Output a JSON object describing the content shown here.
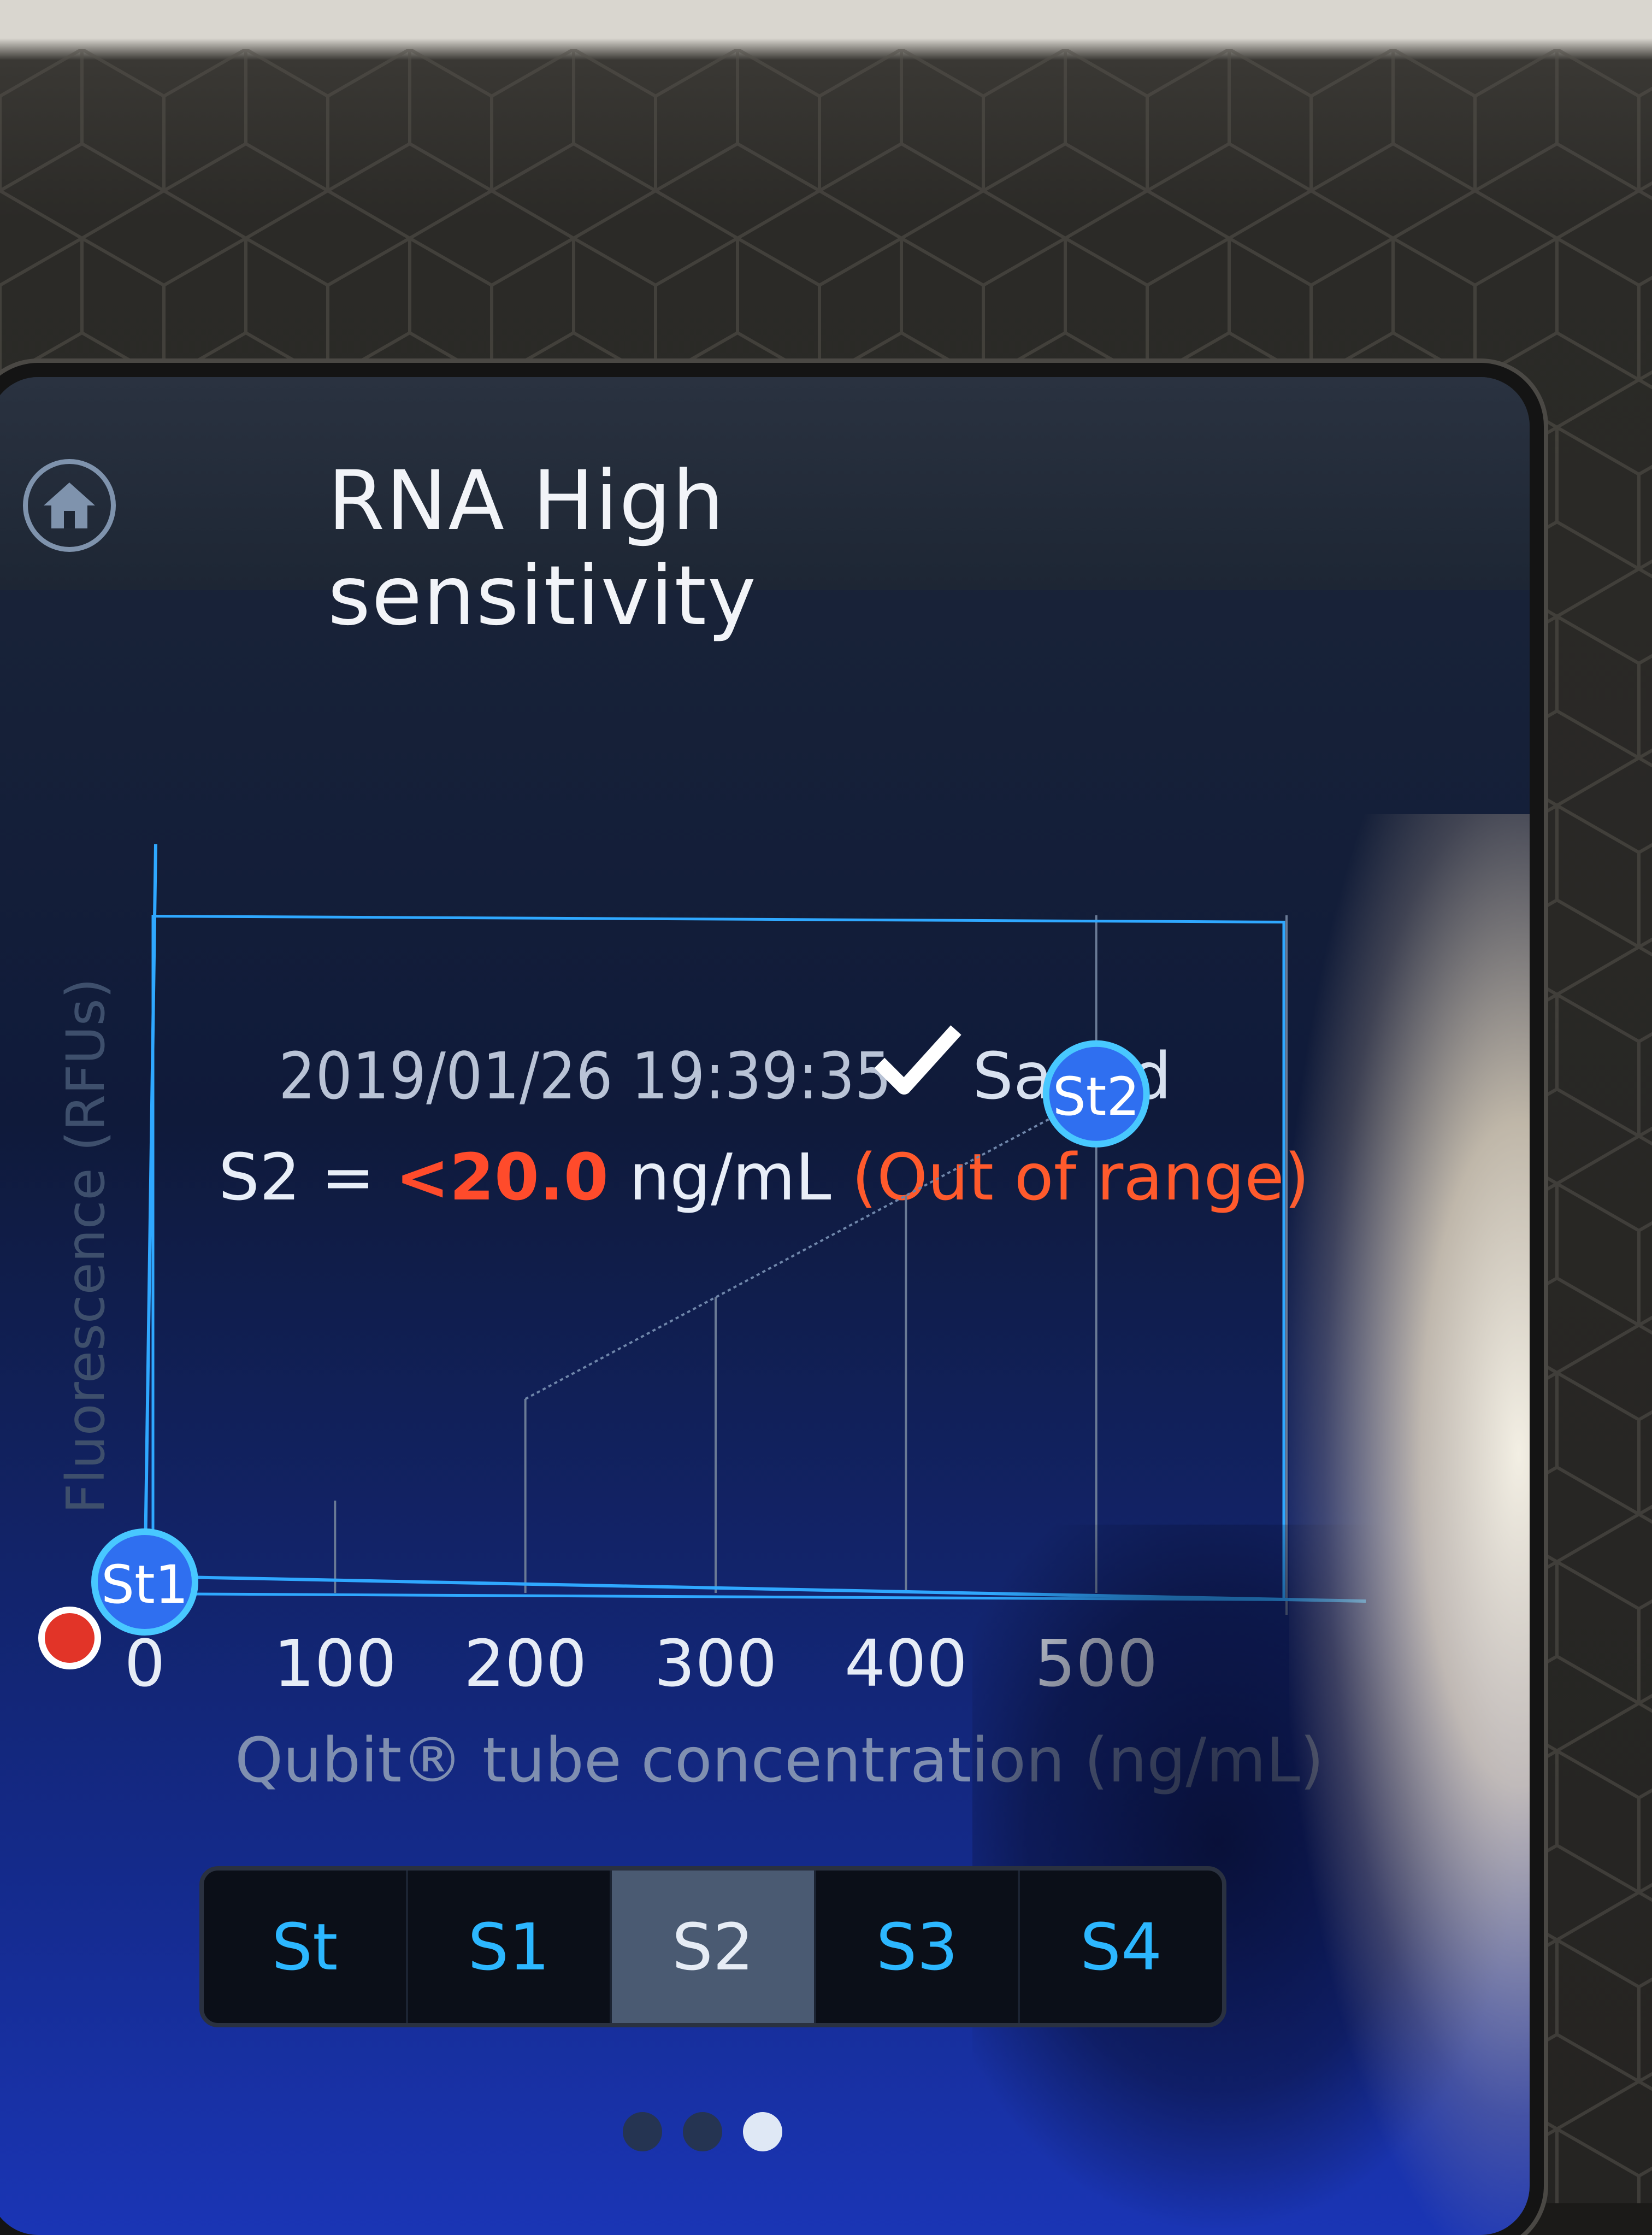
{
  "header": {
    "title": "RNA High sensitivity"
  },
  "status": {
    "timestamp": "2019/01/26 19:39:35",
    "saved_label": "Saved"
  },
  "result": {
    "sample": "S2",
    "equals": " = ",
    "value": "<20.0",
    "unit": " ng/mL ",
    "status": "(Out of range)"
  },
  "chart_data": {
    "type": "scatter",
    "xlabel": "Qubit® tube concentration (ng/mL)",
    "ylabel": "Fluorescence (RFUs)",
    "x_ticks": [
      "0",
      "100",
      "200",
      "300",
      "400",
      "500"
    ],
    "xlim": [
      0,
      600
    ],
    "points": [
      {
        "label": "St1",
        "x": 0,
        "y": 0
      },
      {
        "label": "St2",
        "x": 500,
        "y": 0.88
      }
    ],
    "trend_line": {
      "from": [
        200,
        0.33
      ],
      "to": [
        500,
        0.88
      ]
    },
    "grid": "vertical",
    "colors": {
      "axis": "#2fa8ff",
      "gridline": "#6a7a95",
      "marker": "#2f6ff0",
      "marker_edge": "#48c8ff"
    }
  },
  "tabs": [
    {
      "label": "St",
      "selected": false
    },
    {
      "label": "S1",
      "selected": false
    },
    {
      "label": "S2",
      "selected": true
    },
    {
      "label": "S3",
      "selected": false
    },
    {
      "label": "S4",
      "selected": false
    }
  ],
  "pagination": {
    "count": 3,
    "active_index": 2
  },
  "icons": {
    "home": "home-icon",
    "saved": "check-icon",
    "indicator": "red-status-indicator"
  }
}
